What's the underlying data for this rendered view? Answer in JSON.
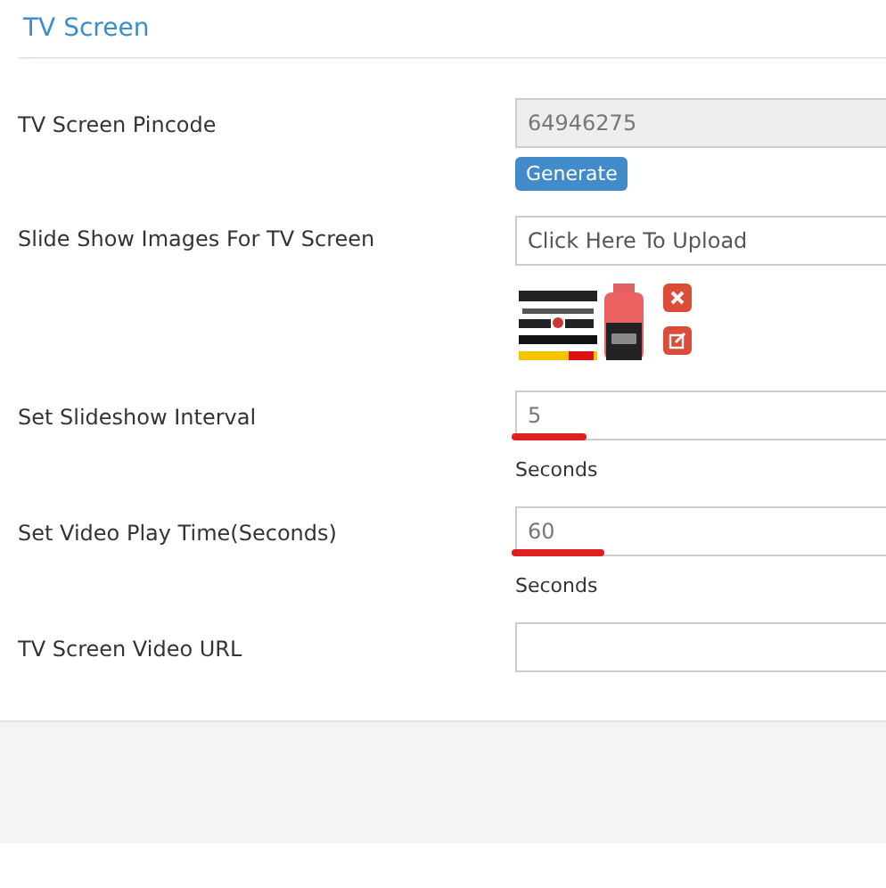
{
  "title": "TV Screen",
  "rows": [
    {
      "kind": "pincode",
      "label": "TV Screen Pincode",
      "value": "64946275",
      "disabled": true,
      "button": "Generate"
    },
    {
      "kind": "upload",
      "label": "Slide Show Images For TV Screen",
      "placeholder": "Click Here To Upload"
    },
    {
      "kind": "number",
      "label": "Set Slideshow Interval",
      "value": "5",
      "highlighted": true,
      "note": "Seconds"
    },
    {
      "kind": "number",
      "label": "Set Video Play Time(Seconds)",
      "value": "60",
      "highlighted": true,
      "note": "Seconds"
    },
    {
      "kind": "text",
      "label": "TV Screen Video URL",
      "value": ""
    }
  ]
}
